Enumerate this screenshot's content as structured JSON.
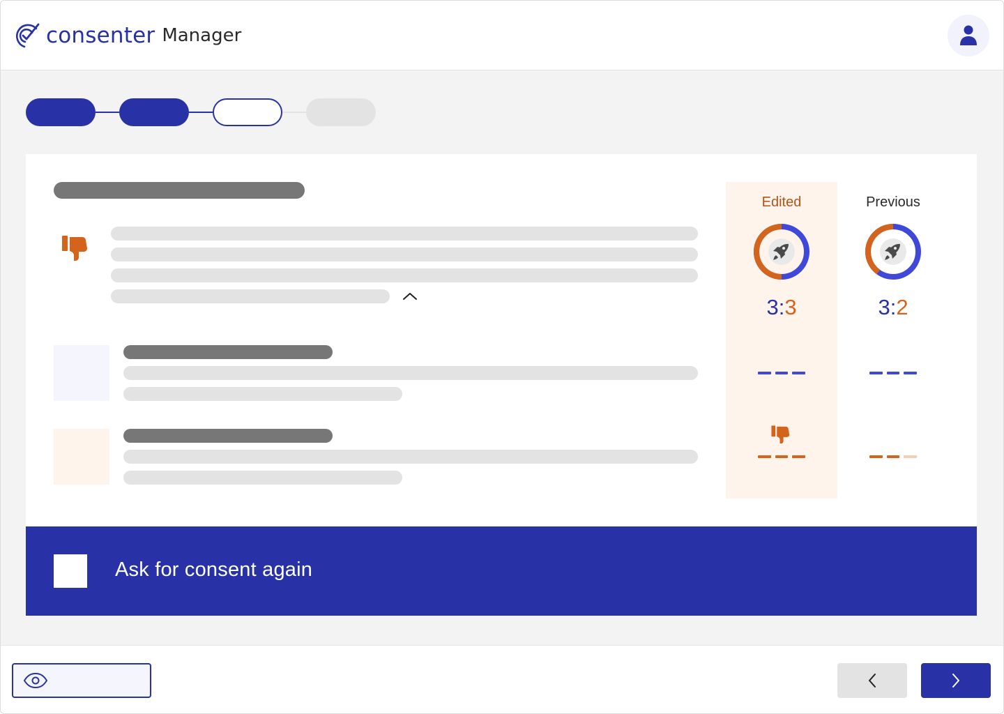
{
  "header": {
    "logo_word": "consenter",
    "logo_sub": "Manager"
  },
  "stepper": {
    "steps": [
      {
        "state": "done"
      },
      {
        "state": "done"
      },
      {
        "state": "current"
      },
      {
        "state": "todo"
      }
    ]
  },
  "comparison": {
    "edited": {
      "title": "Edited",
      "ratio_left": "3",
      "ratio_sep": ":",
      "ratio_right": "3",
      "donut_orange_fraction": 0.5
    },
    "previous": {
      "title": "Previous",
      "ratio_left": "3",
      "ratio_sep": ":",
      "ratio_right": "2",
      "donut_orange_fraction": 0.4
    }
  },
  "banner": {
    "checkbox_label": "Ask for consent again",
    "checked": false
  },
  "icons": {
    "logo": "consenter-logo-icon",
    "user": "user-icon",
    "thumbs_down": "thumbs-down-icon",
    "chevron_up": "chevron-up-icon",
    "rocket": "rocket-icon",
    "eye": "eye-icon",
    "back": "chevron-left-icon",
    "next": "chevron-right-icon"
  },
  "colors": {
    "brand": "#2832a6",
    "accent_orange": "#d4641c",
    "accent_orange_dark": "#b5541a",
    "soft_orange": "#fff4ec",
    "soft_blue": "#f4f5fd",
    "blue_ring": "#3f48d8",
    "light_orange_dash": "#f8ccb0"
  }
}
